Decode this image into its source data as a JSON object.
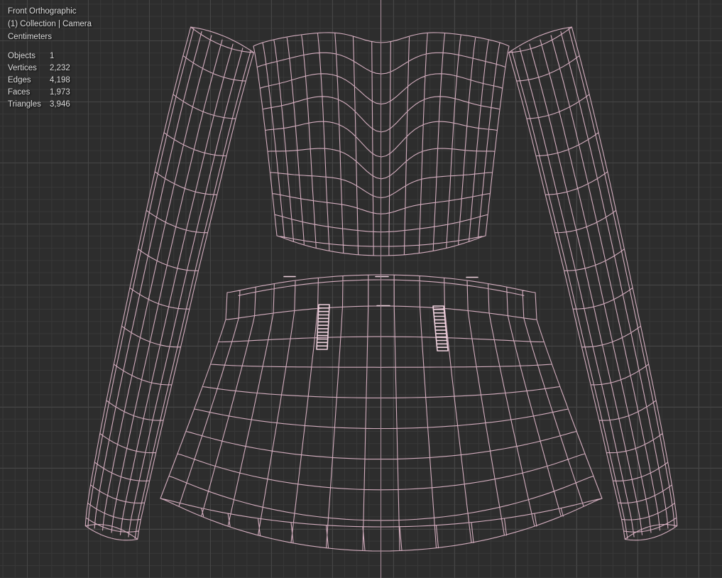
{
  "viewport": {
    "view_label": "Front Orthographic",
    "context_label": "(1) Collection | Camera",
    "units_label": "Centimeters",
    "stats": [
      {
        "label": "Objects",
        "value": "1"
      },
      {
        "label": "Vertices",
        "value": "2,232"
      },
      {
        "label": "Edges",
        "value": "4,198"
      },
      {
        "label": "Faces",
        "value": "1,973"
      },
      {
        "label": "Triangles",
        "value": "3,946"
      }
    ],
    "colors": {
      "background": "#2d2d2d",
      "grid_minor": "#383838",
      "grid_major": "#464646",
      "wire": "#dcb4c6",
      "wire_bright": "#f0d2de",
      "axis": "#ab8e9c",
      "text": "#dcdcdc"
    }
  }
}
